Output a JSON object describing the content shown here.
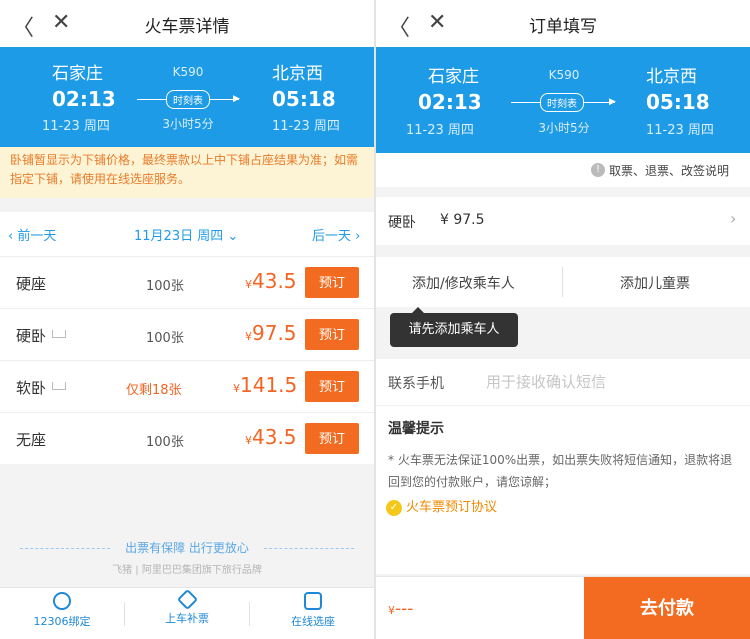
{
  "left": {
    "nav": {
      "back": "〈",
      "close": "✕",
      "title": "火车票详情"
    },
    "trip": {
      "from": "石家庄",
      "to": "北京西",
      "train_no": "K590",
      "depart_time": "02:13",
      "arrive_time": "05:18",
      "depart_date": "11-23 周四",
      "arrive_date": "11-23 周四",
      "timetable": "时刻表",
      "duration": "3小时5分"
    },
    "notice": "卧铺暂显示为下铺价格，最终票款以上中下铺占座结果为准；如需指定下铺，请使用在线选座服务。",
    "daybar": {
      "prev": "‹ 前一天",
      "current": "11月23日 周四 ⌄",
      "next": "后一天 ›"
    },
    "seats": [
      {
        "name": "硬座",
        "count": "100张",
        "currency": "¥",
        "price": "43.5",
        "book": "预订",
        "bed": false,
        "warn": false
      },
      {
        "name": "硬卧",
        "count": "100张",
        "currency": "¥",
        "price": "97.5",
        "book": "预订",
        "bed": true,
        "warn": false
      },
      {
        "name": "软卧",
        "count": "仅剩18张",
        "currency": "¥",
        "price": "141.5",
        "book": "预订",
        "bed": true,
        "warn": true
      },
      {
        "name": "无座",
        "count": "100张",
        "currency": "¥",
        "price": "43.5",
        "book": "预订",
        "bed": false,
        "warn": false
      }
    ],
    "guarantee": "出票有保障 出行更放心",
    "brand": "飞猪 | 阿里巴巴集团旗下旅行品牌",
    "bottom_nav": [
      {
        "label": "12306绑定",
        "icon": "bind-icon"
      },
      {
        "label": "上车补票",
        "icon": "ticket-icon"
      },
      {
        "label": "在线选座",
        "icon": "seat-icon"
      }
    ]
  },
  "right": {
    "nav": {
      "back": "〈",
      "close": "✕",
      "title": "订单填写"
    },
    "trip": {
      "from": "石家庄",
      "to": "北京西",
      "train_no": "K590",
      "depart_time": "02:13",
      "arrive_time": "05:18",
      "depart_date": "11-23 周四",
      "arrive_date": "11-23 周四",
      "timetable": "时刻表",
      "duration": "3小时5分"
    },
    "rules": "取票、退票、改签说明",
    "seat": {
      "name": "硬卧",
      "price": "¥ 97.5"
    },
    "passenger": {
      "add": "添加/修改乘车人",
      "child": "添加儿童票"
    },
    "tooltip": "请先添加乘车人",
    "phone": {
      "label": "联系手机",
      "placeholder": "用于接收确认短信"
    },
    "tips": {
      "heading": "温馨提示",
      "body": "* 火车票无法保证100%出票，如出票失败将短信通知，退款将退回到您的付款账户，请您谅解；",
      "agreement": "火车票预订协议"
    },
    "pay": {
      "currency": "¥",
      "amount": "---",
      "button": "去付款"
    }
  },
  "colors": {
    "primary_blue": "#1e9be6",
    "accent_orange": "#f36b21",
    "notice_bg": "#fdf4d5"
  }
}
